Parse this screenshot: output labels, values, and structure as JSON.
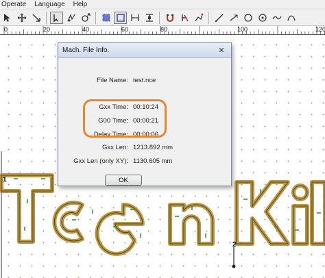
{
  "menubar": {
    "items": [
      "Operate",
      "Language",
      "Help"
    ]
  },
  "toolbar": {
    "icons": [
      "pointer-tool",
      "move-tool",
      "arrow-tool",
      "cut-start-tool",
      "mirror-tool",
      "square-select-tool",
      "square-tool",
      "frame-tool",
      "horizontal-spacing-tool",
      "vertical-spacing-tool",
      "magnet-tool",
      "no-tool",
      "path-tool",
      "line-tool",
      "circle-tool",
      "target-tool",
      "chain-tool",
      "curve-tool"
    ]
  },
  "ruler": {
    "labels": [
      "0",
      "20",
      "40",
      "60",
      "80",
      "100",
      "120"
    ]
  },
  "canvas": {
    "labels": [
      "1",
      "2"
    ],
    "path_color": "#b58c2f",
    "inner_color": "#6a5a2a"
  },
  "dialog": {
    "title": "Mach. File Info.",
    "close_glyph": "✕",
    "rows": [
      {
        "label": "File Name:",
        "value": "test.nce"
      },
      {
        "label": "Gxx Time:",
        "value": "00:10:24"
      },
      {
        "label": "G00 Time:",
        "value": "00:00:21"
      },
      {
        "label": "Delay Time:",
        "value": "00:00:06"
      },
      {
        "label": "Gxx Len:",
        "value": "1213.892 mm"
      },
      {
        "label": "Gxx Len (only XY):",
        "value": "1130.605 mm"
      }
    ],
    "highlight_color": "#e8862c",
    "ok_label": "OK"
  }
}
